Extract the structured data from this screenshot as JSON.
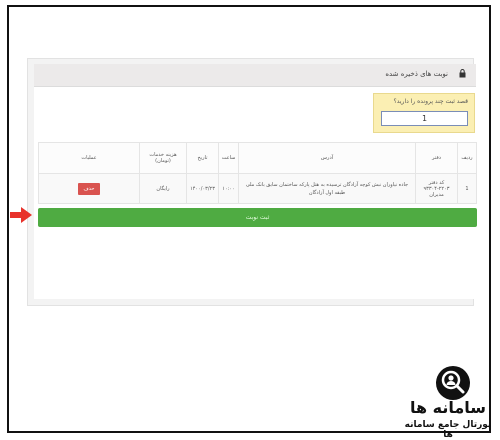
{
  "panel": {
    "title": "نوبت های ذخیره شده",
    "icon": "lock-icon"
  },
  "question": {
    "label": "قصد ثبت چند پرونده را دارید؟",
    "value": "1"
  },
  "table": {
    "headers": [
      "ردیف",
      "دفتر",
      "آدرس",
      "ساعت",
      "تاریخ",
      "هزینه خدمات (تومان)",
      "عملیات"
    ],
    "rows": [
      {
        "index": "1",
        "office": "کد دفتر ۲۲۰۳-۹۳۳۰۴ مدیران",
        "address": "جاده نیاوران نبش کوچه آزادگان ترسیده به هتل پارکه ساختمان سایق بانک ملی طبقه اول آزادگان",
        "time": "۱۰:۰۰",
        "date": "۱۴۰۰/۰۳/۲۳",
        "fee": "رایگان",
        "action": "حذف"
      }
    ]
  },
  "submit_label": "ثبت نوبت",
  "colors": {
    "submit_green": "#4fab42",
    "delete_red": "#d9534f",
    "question_bg": "#fbefb3",
    "arrow_red": "#e8322b"
  },
  "logo": {
    "title": "سامانه ها",
    "subtitle": "پورتال جامع سامانه ها",
    "icon": "search-person-icon"
  }
}
